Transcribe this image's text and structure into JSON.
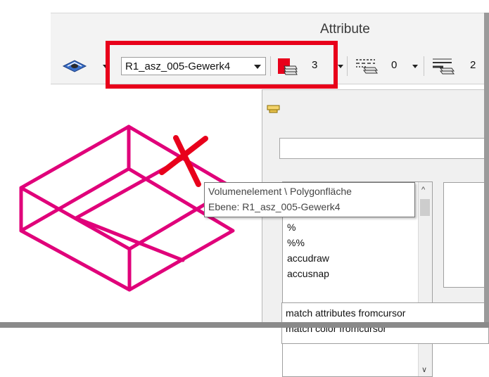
{
  "ribbon": {
    "title": "Attribute",
    "level_combo_value": "R1_asz_005-Gewerk4",
    "color_value": "3",
    "linestyle_value": "0",
    "lineweight_value": "2",
    "colors": {
      "highlight": "#e8001b",
      "color_swatch": "#e8001b"
    }
  },
  "panel": {
    "key_in_list": [
      "%",
      "%%",
      "accudraw",
      "accusnap"
    ],
    "history_list": [
      "match attributes fromcursor",
      "match color fromcursor"
    ]
  },
  "tooltip": {
    "line1": "Volumenelement \\ Polygonfläche",
    "line2": "Ebene: R1_asz_005-Gewerk4"
  },
  "canvas": {
    "element_color": "#e0007a",
    "cursor_color": "#e8001b"
  }
}
